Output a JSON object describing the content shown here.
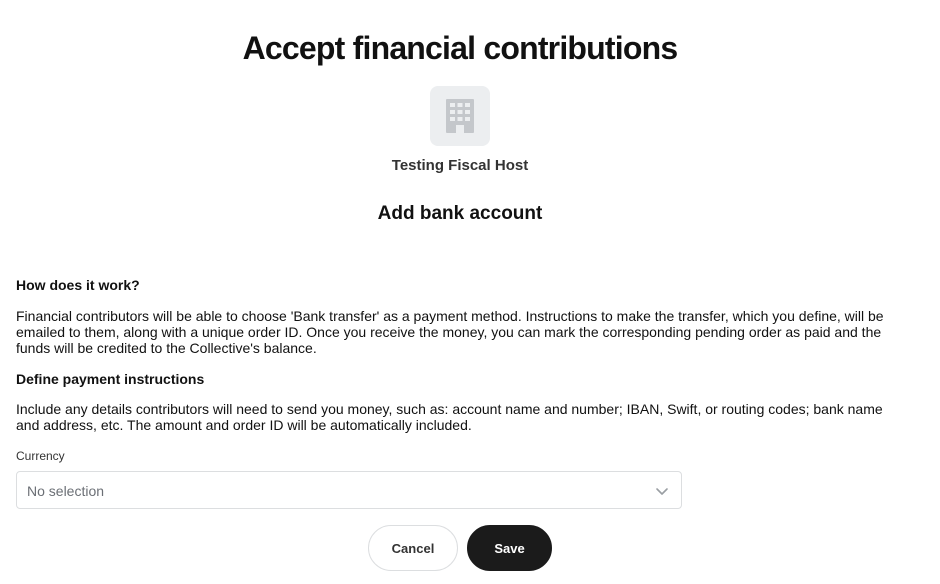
{
  "header": {
    "title": "Accept financial contributions",
    "host_name": "Testing Fiscal Host",
    "subtitle": "Add bank account",
    "avatar_icon": "building-icon"
  },
  "how_it_works": {
    "heading": "How does it work?",
    "text": "Financial contributors will be able to choose 'Bank transfer' as a payment method. Instructions to make the transfer, which you define, will be emailed to them, along with a unique order ID. Once you receive the money, you can mark the corresponding pending order as paid and the funds will be credited to the Collective's balance."
  },
  "payment_instructions": {
    "heading": "Define payment instructions",
    "text": "Include any details contributors will need to send you money, such as: account name and number; IBAN, Swift, or routing codes; bank name and address, etc. The amount and order ID will be automatically included."
  },
  "currency": {
    "label": "Currency",
    "value": "No selection",
    "icon": "chevron-down-icon"
  },
  "actions": {
    "cancel_label": "Cancel",
    "save_label": "Save"
  },
  "colors": {
    "primary_button": "#1b1b1b",
    "avatar_background": "#eceef0",
    "border": "#dcdee0"
  }
}
